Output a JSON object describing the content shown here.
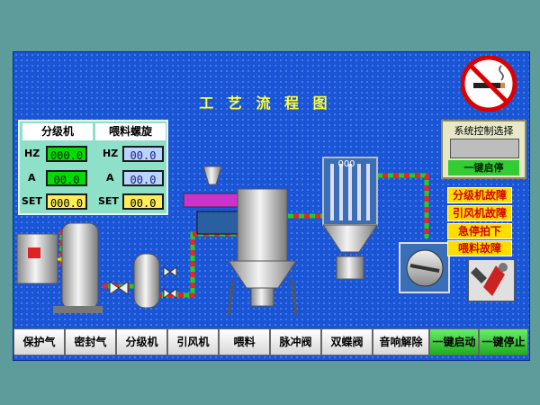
{
  "title": "工 艺 流 程 图",
  "panel": {
    "col1_header": "分级机",
    "col2_header": "喂料螺旋",
    "rows": [
      {
        "label": "HZ",
        "v1": "000.0",
        "label2": "HZ",
        "v2": "00.0"
      },
      {
        "label": "A",
        "v1": "00.0",
        "label2": "A",
        "v2": "00.0"
      },
      {
        "label": "SET",
        "v1": "000.0",
        "label2": "SET",
        "v2": "00.0"
      }
    ]
  },
  "control": {
    "title": "系统控制选择",
    "start_label": "一键启停"
  },
  "alarms": [
    "分级机故障",
    "引风机故障",
    "急停拍下",
    "喂料故障"
  ],
  "buttons": [
    "保护气",
    "密封气",
    "分级机",
    "引风机",
    "喂料",
    "脉冲阀",
    "双蝶阀",
    "音响解除",
    "一键启动",
    "一键停止"
  ],
  "filter_label": "000",
  "colors": {
    "screen_bg": "#1a55d6",
    "frame": "#5e9c9c",
    "alarm_bg": "#ffdd00",
    "alarm_text": "#d00000",
    "title": "#ffff33"
  },
  "icons": [
    "no-smoking-icon",
    "tools-icon",
    "rotary-valve-icon"
  ]
}
